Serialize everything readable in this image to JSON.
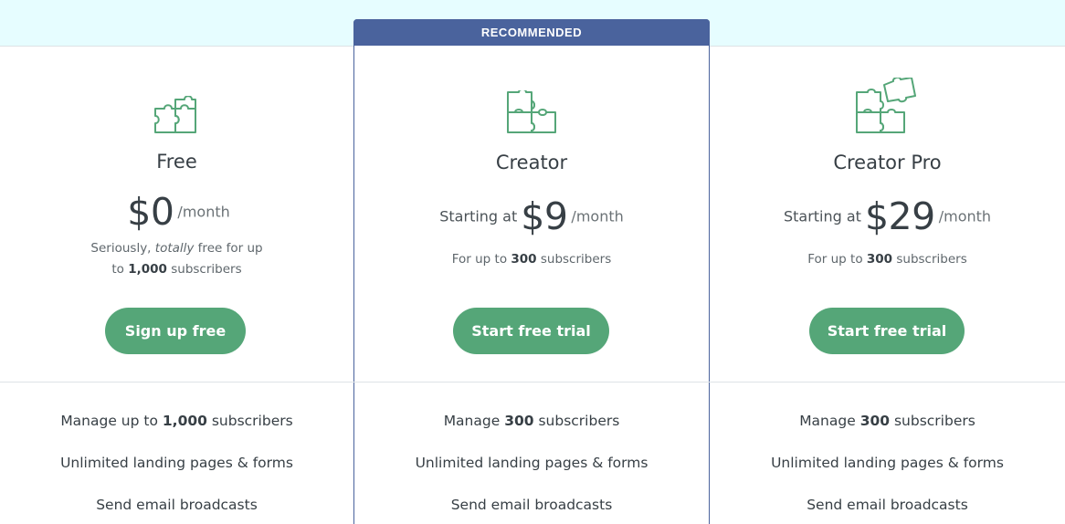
{
  "banner": {
    "label": "RECOMMENDED"
  },
  "colors": {
    "accent_green": "#55a678",
    "banner_blue": "#4a639d",
    "top_band": "#e6fdff",
    "icon_green": "#55a678"
  },
  "plans": {
    "free": {
      "icon": "puzzle-small-icon",
      "name": "Free",
      "price_prefix": "",
      "price": "$0",
      "price_unit": "/month",
      "note_line1_a": "Seriously, ",
      "note_line1_em": "totally",
      "note_line1_b": " free for up",
      "note_line2_a": "to ",
      "note_line2_bold": "1,000",
      "note_line2_b": " subscribers",
      "cta": "Sign up free",
      "features": [
        {
          "a": "Manage up to ",
          "bold": "1,000",
          "b": " subscribers"
        },
        {
          "a": "Unlimited landing pages & forms",
          "bold": "",
          "b": ""
        },
        {
          "a": "Send email broadcasts",
          "bold": "",
          "b": ""
        }
      ]
    },
    "creator": {
      "icon": "puzzle-medium-icon",
      "name": "Creator",
      "price_prefix": "Starting at",
      "price": "$9",
      "price_unit": "/month",
      "note_a": "For up to ",
      "note_bold": "300",
      "note_b": " subscribers",
      "cta": "Start free trial",
      "features": [
        {
          "a": "Manage ",
          "bold": "300",
          "b": " subscribers"
        },
        {
          "a": "Unlimited landing pages & forms",
          "bold": "",
          "b": ""
        },
        {
          "a": "Send email broadcasts",
          "bold": "",
          "b": ""
        }
      ]
    },
    "pro": {
      "icon": "puzzle-large-icon",
      "name": "Creator Pro",
      "price_prefix": "Starting at",
      "price": "$29",
      "price_unit": "/month",
      "note_a": "For up to ",
      "note_bold": "300",
      "note_b": " subscribers",
      "cta": "Start free trial",
      "features": [
        {
          "a": "Manage ",
          "bold": "300",
          "b": " subscribers"
        },
        {
          "a": "Unlimited landing pages & forms",
          "bold": "",
          "b": ""
        },
        {
          "a": "Send email broadcasts",
          "bold": "",
          "b": ""
        }
      ]
    }
  }
}
